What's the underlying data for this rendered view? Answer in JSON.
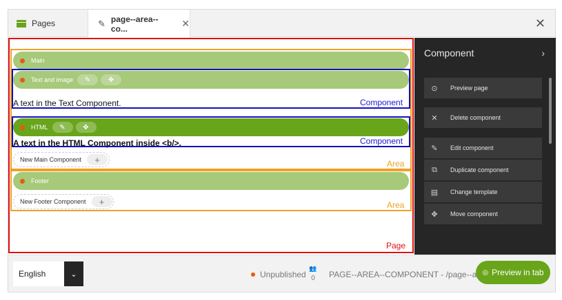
{
  "tabs": {
    "pages_label": "Pages",
    "active_label": "page--area--co...",
    "pencil_glyph": "✎",
    "close_glyph": "✕",
    "window_close_glyph": "✕"
  },
  "editor": {
    "main_bar": "Main",
    "text_image_bar": "Text and image",
    "text_component_content": "A text in the Text Component.",
    "html_bar": "HTML",
    "html_component_content": "A text in the HTML Component inside <b/>.",
    "component_label": "Component",
    "new_main_component": "New Main Component",
    "area_label": "Area",
    "footer_bar": "Footer",
    "new_footer_component": "New Footer Component",
    "page_label": "Page",
    "edit_glyph": "✎",
    "move_glyph": "✥",
    "plus_glyph": "+"
  },
  "panel": {
    "title": "Component",
    "chevron": "›",
    "actions": [
      {
        "label": "Preview page",
        "icon": "⊙"
      },
      {
        "label": "Delete component",
        "icon": "✕"
      },
      {
        "label": "Edit component",
        "icon": "✎"
      },
      {
        "label": "Duplicate component",
        "icon": "⧉"
      },
      {
        "label": "Change template",
        "icon": "▤"
      },
      {
        "label": "Move component",
        "icon": "✥"
      }
    ]
  },
  "footer": {
    "language": "English",
    "language_chevron": "⌄",
    "status": "Unpublished",
    "users_glyph": "👥",
    "users_count": "0",
    "breadcrumb": "PAGE--AREA--COMPONENT - /page--ar...",
    "preview_label": "Preview in tab",
    "preview_icon": "◎"
  },
  "colors": {
    "accent_green": "#68a51b",
    "light_green": "#a6c97a",
    "page_border": "#e01010",
    "area_border": "#f0a020",
    "component_border": "#1010c0",
    "status_dot": "#e85a10",
    "panel_bg": "#262626"
  }
}
